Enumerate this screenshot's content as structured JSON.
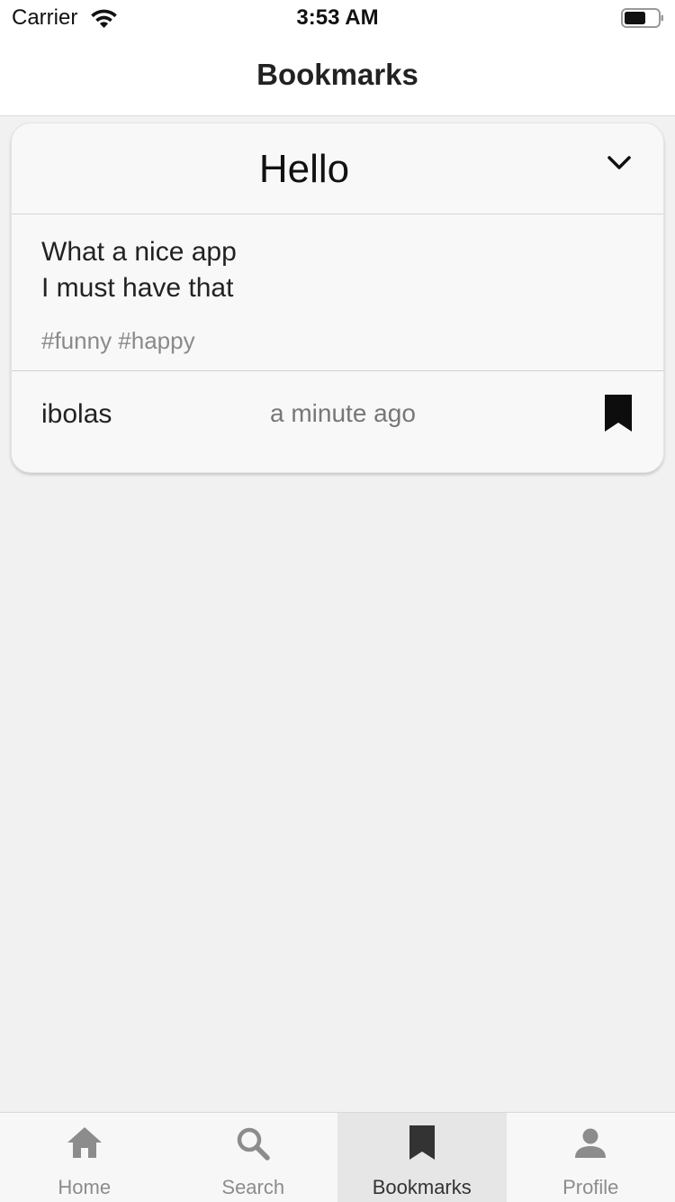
{
  "status_bar": {
    "carrier": "Carrier",
    "time": "3:53 AM"
  },
  "header": {
    "title": "Bookmarks"
  },
  "post": {
    "title": "Hello",
    "lines": [
      "What a nice app",
      "I must have that"
    ],
    "tags": "#funny #happy",
    "author": "ibolas",
    "time_ago": "a minute ago",
    "bookmarked": true
  },
  "tabs": [
    {
      "label": "Home",
      "icon": "home-icon",
      "active": false
    },
    {
      "label": "Search",
      "icon": "search-icon",
      "active": false
    },
    {
      "label": "Bookmarks",
      "icon": "bookmark-icon",
      "active": true
    },
    {
      "label": "Profile",
      "icon": "profile-icon",
      "active": false
    }
  ],
  "colors": {
    "background": "#f1f1f1",
    "active_tab": "#e6e6e6",
    "inactive_icon": "#8c8c8c",
    "active_icon": "#333333"
  }
}
